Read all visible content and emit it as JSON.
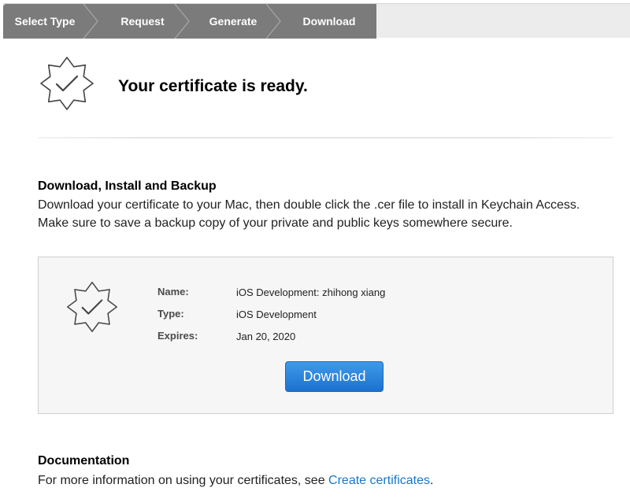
{
  "steps": [
    {
      "label": "Select Type",
      "state": "done"
    },
    {
      "label": "Request",
      "state": "done"
    },
    {
      "label": "Generate",
      "state": "done"
    },
    {
      "label": "Download",
      "state": "current"
    }
  ],
  "header": {
    "icon": "certificate-badge-check-icon",
    "title": "Your certificate is ready."
  },
  "backup": {
    "title": "Download, Install and Backup",
    "line1": "Download your certificate to your Mac, then double click the .cer file to install in Keychain Access.",
    "line2": "Make sure to save a backup copy of your private and public keys somewhere secure."
  },
  "certificate": {
    "icon": "certificate-badge-check-icon",
    "name_label": "Name:",
    "name_value": "iOS Development: zhihong xiang",
    "type_label": "Type:",
    "type_value": "iOS Development",
    "expires_label": "Expires:",
    "expires_value": "Jan 20, 2020",
    "download_label": "Download"
  },
  "documentation": {
    "title": "Documentation",
    "text_prefix": "For more information on using your certificates, see ",
    "link_text": "Create certificates",
    "text_suffix": "."
  },
  "colors": {
    "step_active": "#7b7b7b",
    "step_bar_bg": "#ececec",
    "button_blue": "#1d71cf",
    "link_blue": "#1a75c8"
  }
}
